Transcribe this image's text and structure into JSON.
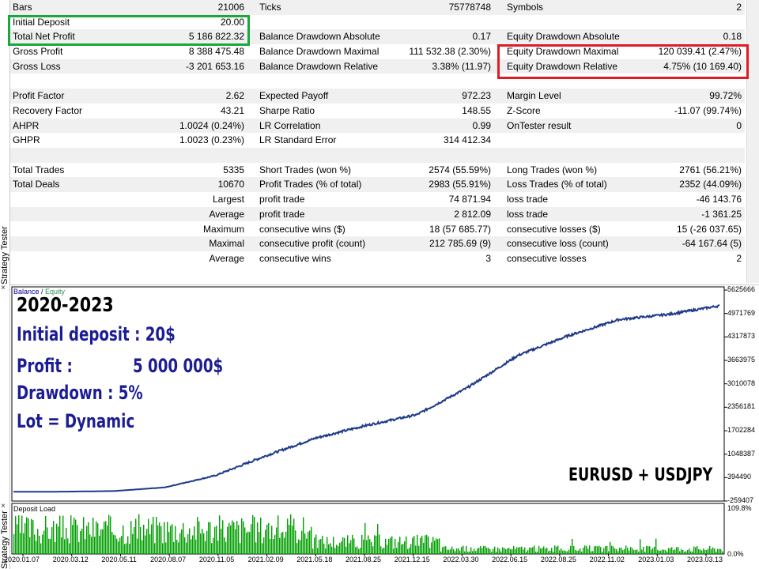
{
  "window": {
    "side_label": "Strategy Tester",
    "close_glyph": "×"
  },
  "report": {
    "rows": [
      {
        "l1": "Bars",
        "v1": "21006",
        "l2": "Ticks",
        "v2": "75778748",
        "l3": "Symbols",
        "v3": "2"
      },
      {
        "l1": "Initial Deposit",
        "v1": "20.00",
        "l2": "",
        "v2": "",
        "l3": "",
        "v3": ""
      },
      {
        "l1": "Total Net Profit",
        "v1": "5 186 822.32",
        "l2": "Balance Drawdown Absolute",
        "v2": "0.17",
        "l3": "Equity Drawdown Absolute",
        "v3": "0.18"
      },
      {
        "l1": "Gross Profit",
        "v1": "8 388 475.48",
        "l2": "Balance Drawdown Maximal",
        "v2": "111 532.38 (2.30%)",
        "l3": "Equity Drawdown Maximal",
        "v3": "120 039.41 (2.47%)"
      },
      {
        "l1": "Gross Loss",
        "v1": "-3 201 653.16",
        "l2": "Balance Drawdown Relative",
        "v2": "3.38% (11.97)",
        "l3": "Equity Drawdown Relative",
        "v3": "4.75% (10 169.40)"
      },
      {
        "l1": "",
        "v1": "",
        "l2": "",
        "v2": "",
        "l3": "",
        "v3": ""
      },
      {
        "l1": "Profit Factor",
        "v1": "2.62",
        "l2": "Expected Payoff",
        "v2": "972.23",
        "l3": "Margin Level",
        "v3": "99.72%"
      },
      {
        "l1": "Recovery Factor",
        "v1": "43.21",
        "l2": "Sharpe Ratio",
        "v2": "148.55",
        "l3": "Z-Score",
        "v3": "-11.07 (99.74%)"
      },
      {
        "l1": "AHPR",
        "v1": "1.0024 (0.24%)",
        "l2": "LR Correlation",
        "v2": "0.99",
        "l3": "OnTester result",
        "v3": "0"
      },
      {
        "l1": "GHPR",
        "v1": "1.0023 (0.23%)",
        "l2": "LR Standard Error",
        "v2": "314 412.34",
        "l3": "",
        "v3": ""
      },
      {
        "l1": "",
        "v1": "",
        "l2": "",
        "v2": "",
        "l3": "",
        "v3": ""
      },
      {
        "l1": "Total Trades",
        "v1": "5335",
        "l2": "Short Trades (won %)",
        "v2": "2574 (55.59%)",
        "l3": "Long Trades (won %)",
        "v3": "2761 (56.21%)"
      },
      {
        "l1": "Total Deals",
        "v1": "10670",
        "l2": "Profit Trades (% of total)",
        "v2": "2983 (55.91%)",
        "l3": "Loss Trades (% of total)",
        "v3": "2352 (44.09%)"
      },
      {
        "l1": "",
        "v1": "Largest",
        "l2": "profit trade",
        "v2": "74 871.94",
        "l3": "loss trade",
        "v3": "-46 143.76"
      },
      {
        "l1": "",
        "v1": "Average",
        "l2": "profit trade",
        "v2": "2 812.09",
        "l3": "loss trade",
        "v3": "-1 361.25"
      },
      {
        "l1": "",
        "v1": "Maximum",
        "l2": "consecutive wins ($)",
        "v2": "18 (57 685.77)",
        "l3": "consecutive losses ($)",
        "v3": "15 (-26 037.65)"
      },
      {
        "l1": "",
        "v1": "Maximal",
        "l2": "consecutive profit (count)",
        "v2": "212 785.69 (9)",
        "l3": "consecutive loss (count)",
        "v3": "-64 167.64 (5)"
      },
      {
        "l1": "",
        "v1": "Average",
        "l2": "consecutive wins",
        "v2": "3",
        "l3": "consecutive losses",
        "v3": "2"
      }
    ]
  },
  "chart": {
    "legend_balance": "Balance",
    "legend_sep": " / ",
    "legend_equity": "Equity",
    "overlay_period": "2020-2023",
    "overlay_deposit": "Initial deposit : 20$",
    "overlay_profit": "Profit :            5 000 000$",
    "overlay_drawdown": "Drawdown : 5%",
    "overlay_lot": "Lot = Dynamic",
    "overlay_pair": "EURUSD + USDJPY",
    "deposit_load_label": "Deposit Load",
    "deposit_load_max": "109.8%",
    "deposit_load_min": "0.0%",
    "line_color": "#1f3a8a",
    "load_color": "#00a000",
    "chart_data": {
      "type": "line",
      "y_ticks": [
        "5625666",
        "4971769",
        "4317873",
        "3663975",
        "3010078",
        "2356181",
        "1702284",
        "1048387",
        "394490",
        "-259407"
      ],
      "x_ticks": [
        "2020.01.07",
        "2020.03.12",
        "2020.05.11",
        "2020.08.07",
        "2020.11.05",
        "2021.02.09",
        "2021.05.18",
        "2021.08.25",
        "2021.12.15",
        "2022.03.30",
        "2022.06.15",
        "2022.08.25",
        "2022.11.02",
        "2023.01.03",
        "2023.03.13"
      ],
      "ylim": [
        -259407,
        5625666
      ],
      "series": [
        {
          "name": "Balance",
          "x": [
            "2020.01.07",
            "2020.03.12",
            "2020.05.11",
            "2020.08.07",
            "2020.11.05",
            "2021.02.09",
            "2021.05.18",
            "2021.08.25",
            "2021.12.15",
            "2022.03.30",
            "2022.06.15",
            "2022.08.25",
            "2022.11.02",
            "2023.01.03",
            "2023.03.13"
          ],
          "values": [
            20,
            2000,
            20000,
            120000,
            450000,
            1000000,
            1500000,
            1850000,
            2150000,
            2900000,
            3800000,
            4350000,
            4800000,
            4950000,
            5186822
          ]
        }
      ]
    }
  }
}
